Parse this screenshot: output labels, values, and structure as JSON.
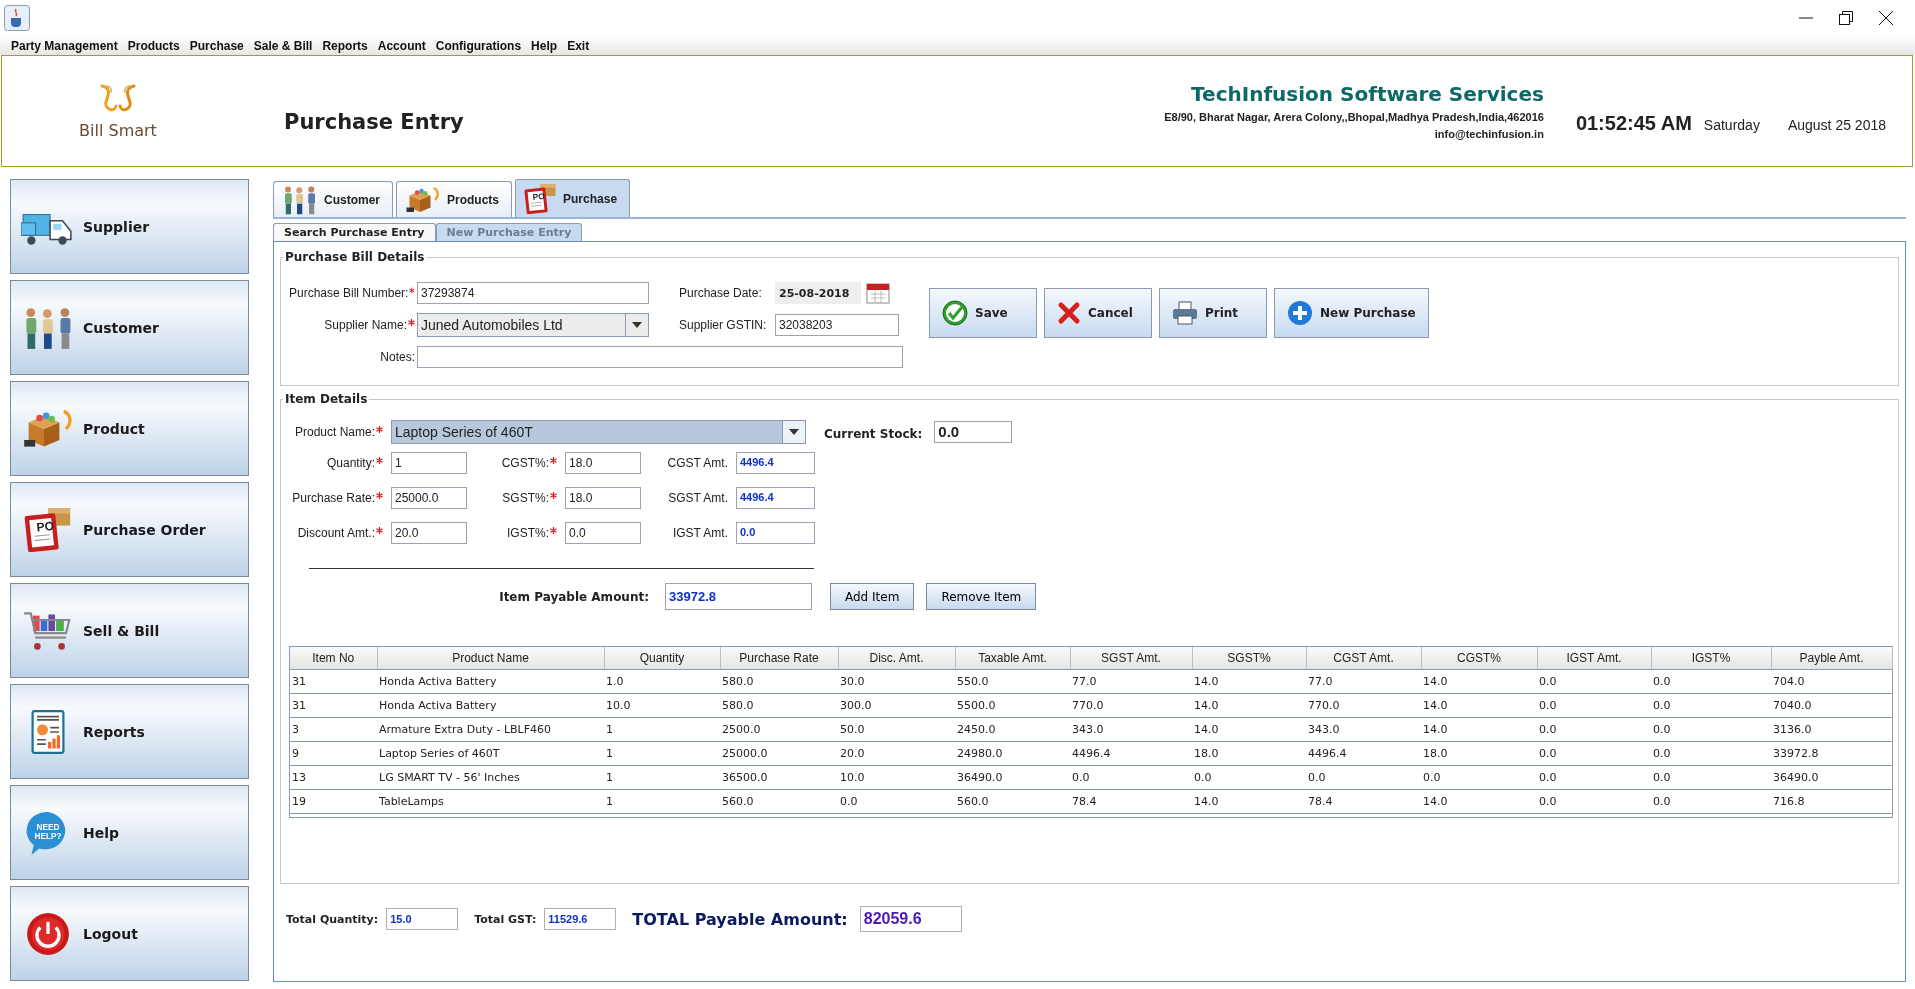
{
  "menu": [
    "Party Management",
    "Products",
    "Purchase",
    "Sale & Bill",
    "Reports",
    "Account",
    "Configurations",
    "Help",
    "Exit"
  ],
  "header": {
    "logo_text": "Bill Smart",
    "page_title": "Purchase Entry",
    "company": "TechInfusion Software Services",
    "address": "E8/90, Bharat Nagar, Arera Colony,,Bhopal,Madhya Pradesh,India,462016",
    "email": "info@techinfusion.in",
    "time": "01:52:45 AM",
    "day": "Saturday",
    "date": "August 25 2018"
  },
  "sidebar": {
    "items": [
      {
        "label": "Supplier",
        "kind": "truck"
      },
      {
        "label": "Customer",
        "kind": "people"
      },
      {
        "label": "Product",
        "kind": "products"
      },
      {
        "label": "Purchase Order",
        "kind": "order",
        "icon_text": "PO"
      },
      {
        "label": "Sell & Bill",
        "kind": "cart"
      },
      {
        "label": "Reports",
        "kind": "report"
      },
      {
        "label": "Help",
        "kind": "help",
        "icon_text": "NEED HELP?"
      },
      {
        "label": "Logout",
        "kind": "power"
      }
    ]
  },
  "tabs": [
    {
      "label": "Customer",
      "kind": "people",
      "selected": false
    },
    {
      "label": "Products",
      "kind": "products",
      "selected": false
    },
    {
      "label": "Purchase",
      "kind": "order",
      "icon_text": "PO",
      "selected": true
    }
  ],
  "subtabs": [
    {
      "label": "Search Purchase Entry",
      "selected": false,
      "disabled": false
    },
    {
      "label": "New Purchase Entry",
      "selected": true,
      "disabled": true
    }
  ],
  "bill_details": {
    "title": "Purchase Bill Details",
    "bill_number": {
      "label": "Purchase Bill Number:",
      "required": true,
      "value": "37293874"
    },
    "supplier_name": {
      "label": "Supplier Name:",
      "required": true,
      "value": "Juned Automobiles Ltd"
    },
    "notes": {
      "label": "Notes:",
      "required": false
    },
    "purchase_date": {
      "label": "Purchase Date:",
      "value": "25-08-2018"
    },
    "supplier_gstin": {
      "label": "Supplier GSTIN:",
      "value": "32038203"
    }
  },
  "actions": [
    {
      "label": "Save",
      "kind": "save"
    },
    {
      "label": "Cancel",
      "kind": "cancel"
    },
    {
      "label": "Print",
      "kind": "print"
    },
    {
      "label": "New Purchase",
      "kind": "new"
    }
  ],
  "item_details": {
    "title": "Item Details",
    "product_name": {
      "label": "Product Name:",
      "required": true,
      "value": "Laptop Series of 460T"
    },
    "current_stock": {
      "label": "Current Stock:",
      "value": "0.0"
    },
    "fields": [
      {
        "label": "Quantity:",
        "required": true,
        "kind": "input",
        "value": "1"
      },
      {
        "label": "CGST%:",
        "required": true,
        "kind": "input",
        "value": "18.0"
      },
      {
        "label": "CGST Amt.",
        "required": false,
        "kind": "amount",
        "value": "4496.4"
      },
      {
        "label": "Purchase Rate:",
        "required": true,
        "kind": "input",
        "value": "25000.0"
      },
      {
        "label": "SGST%:",
        "required": true,
        "kind": "input",
        "value": "18.0"
      },
      {
        "label": "SGST Amt.",
        "required": false,
        "kind": "amount",
        "value": "4496.4"
      },
      {
        "label": "Discount Amt.:",
        "required": true,
        "kind": "input",
        "value": "20.0"
      },
      {
        "label": "IGST%:",
        "required": true,
        "kind": "input",
        "value": "0.0"
      },
      {
        "label": "IGST Amt.",
        "required": false,
        "kind": "amount",
        "value": "0.0"
      }
    ],
    "item_payable": {
      "label": "Item Payable Amount:",
      "value": "33972.8"
    },
    "buttons": [
      "Add Item",
      "Remove Item"
    ]
  },
  "table": {
    "columns": [
      "Item No",
      "Product Name",
      "Quantity",
      "Purchase Rate",
      "Disc. Amt.",
      "Taxable Amt.",
      "SGST Amt.",
      "SGST%",
      "CGST Amt.",
      "CGST%",
      "IGST Amt.",
      "IGST%",
      "Payble Amt."
    ],
    "rows": [
      [
        "31",
        "Honda Activa Battery",
        "1.0",
        "580.0",
        "30.0",
        "550.0",
        "77.0",
        "14.0",
        "77.0",
        "14.0",
        "0.0",
        "0.0",
        "704.0"
      ],
      [
        "31",
        "Honda Activa Battery",
        "10.0",
        "580.0",
        "300.0",
        "5500.0",
        "770.0",
        "14.0",
        "770.0",
        "14.0",
        "0.0",
        "0.0",
        "7040.0"
      ],
      [
        "3",
        "Armature Extra Duty - LBLF460",
        "1",
        "2500.0",
        "50.0",
        "2450.0",
        "343.0",
        "14.0",
        "343.0",
        "14.0",
        "0.0",
        "0.0",
        "3136.0"
      ],
      [
        "9",
        "Laptop Series of 460T",
        "1",
        "25000.0",
        "20.0",
        "24980.0",
        "4496.4",
        "18.0",
        "4496.4",
        "18.0",
        "0.0",
        "0.0",
        "33972.8"
      ],
      [
        "13",
        "LG SMART TV - 56' Inches",
        "1",
        "36500.0",
        "10.0",
        "36490.0",
        "0.0",
        "0.0",
        "0.0",
        "0.0",
        "0.0",
        "0.0",
        "36490.0"
      ],
      [
        "19",
        "TableLamps",
        "1",
        "560.0",
        "0.0",
        "560.0",
        "78.4",
        "14.0",
        "78.4",
        "14.0",
        "0.0",
        "0.0",
        "716.8"
      ]
    ]
  },
  "totals": [
    {
      "label": "Total Quantity:",
      "kind": "small",
      "value": "15.0"
    },
    {
      "label": "Total GST:",
      "kind": "small",
      "value": "11529.6"
    },
    {
      "label": "TOTAL Payable Amount:",
      "kind": "grand",
      "value": "82059.6"
    }
  ]
}
